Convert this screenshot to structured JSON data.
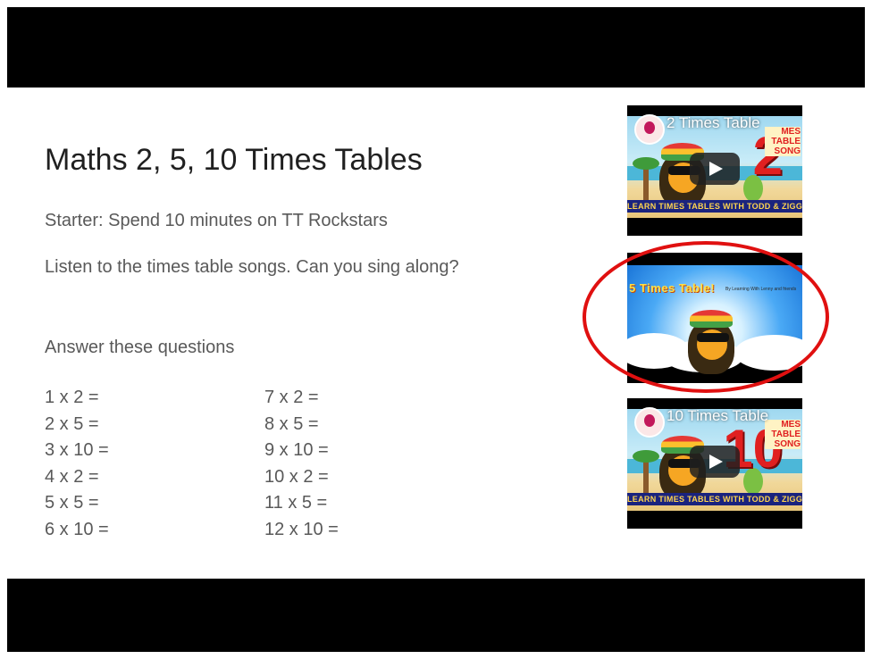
{
  "slide": {
    "title": "Maths 2, 5, 10 Times Tables",
    "starter": "Starter: Spend 10 minutes on TT Rockstars",
    "listen": "Listen to the times table songs. Can you sing along?",
    "answer": "Answer these questions",
    "questions_left": [
      "1 x 2 =",
      "2 x 5 =",
      "3 x 10 =",
      "4 x 2 =",
      "5 x 5 =",
      "6 x 10 ="
    ],
    "questions_right": [
      "7 x 2 =",
      "8 x 5 =",
      "9 x 10 =",
      "10 x 2 =",
      "11 x 5 =",
      "12 x 10 ="
    ]
  },
  "videos": [
    {
      "title": "2 Times Table",
      "big_number": "2",
      "corner_text": "MES TABLE SONG",
      "banner": "LEARN TIMES TABLES WITH TODD & ZIGGY",
      "icon": "play-icon"
    },
    {
      "title": "5 Times Table!",
      "subtitle": "By Learning With Lenny and friends",
      "highlighted": true
    },
    {
      "title": "10 Times Table",
      "big_number": "10",
      "corner_text": "MES TABLE SONG",
      "banner": "LEARN TIMES TABLES WITH TODD & ZIGGY",
      "icon": "play-icon"
    }
  ],
  "colors": {
    "frame": "#000000",
    "title_text": "#202020",
    "body_text": "#595959",
    "highlight": "#e01010"
  }
}
